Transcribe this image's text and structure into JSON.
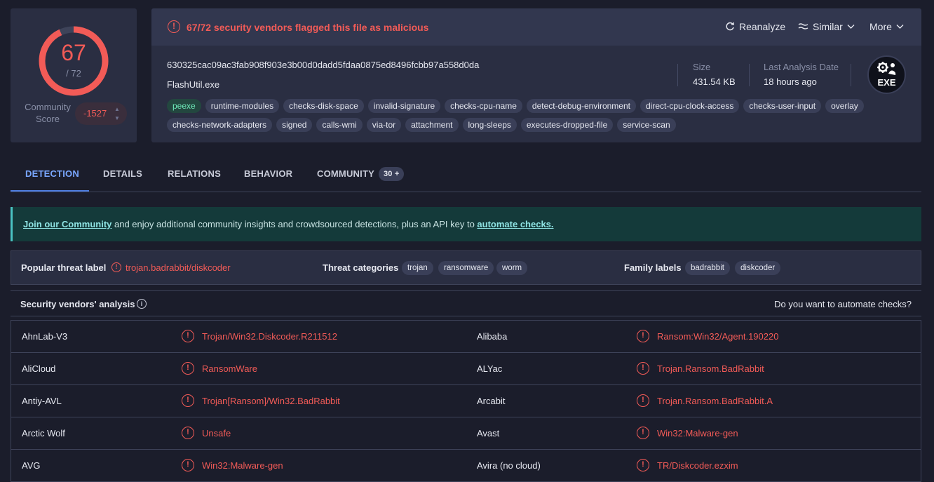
{
  "score": {
    "detected": "67",
    "total": "/ 72",
    "detected_ratio": 0.9306,
    "community_label": "Community Score",
    "community_value": "-1527",
    "ring_color": "#f25b57"
  },
  "summary": {
    "alert_text": "67/72 security vendors flagged this file as malicious",
    "actions": {
      "reanalyze": "Reanalyze",
      "similar": "Similar",
      "more": "More"
    },
    "hash": "630325cac09ac3fab908f903e3b00d0dadd5fdaa0875ed8496fcbb97a558d0da",
    "filename": "FlashUtil.exe",
    "size_label": "Size",
    "size_value": "431.54 KB",
    "date_label": "Last Analysis Date",
    "date_value": "18 hours ago",
    "file_type": "EXE",
    "tags_row1": [
      "peexe",
      "runtime-modules",
      "checks-disk-space",
      "invalid-signature",
      "checks-cpu-name",
      "detect-debug-environment",
      "direct-cpu-clock-access",
      "checks-user-input",
      "overlay"
    ],
    "tags_row2": [
      "checks-network-adapters",
      "signed",
      "calls-wmi",
      "via-tor",
      "attachment",
      "long-sleeps",
      "executes-dropped-file",
      "service-scan"
    ]
  },
  "tabs": {
    "detection": "DETECTION",
    "details": "DETAILS",
    "relations": "RELATIONS",
    "behavior": "BEHAVIOR",
    "community": "COMMUNITY",
    "community_count": "30 +"
  },
  "banner": {
    "link1": "Join our Community",
    "middle": " and enjoy additional community insights and crowdsourced detections, plus an API key to ",
    "link2": "automate checks."
  },
  "threat": {
    "popular_label": "Popular threat label",
    "popular_value": "trojan.badrabbit/diskcoder",
    "categories_label": "Threat categories",
    "categories": [
      "trojan",
      "ransomware",
      "worm"
    ],
    "family_label": "Family labels",
    "families": [
      "badrabbit",
      "diskcoder"
    ]
  },
  "vendors_header": {
    "title": "Security vendors' analysis",
    "right": "Do you want to automate checks?"
  },
  "vendors": [
    {
      "left_name": "AhnLab-V3",
      "left_result": "Trojan/Win32.Diskcoder.R211512",
      "right_name": "Alibaba",
      "right_result": "Ransom:Win32/Agent.190220"
    },
    {
      "left_name": "AliCloud",
      "left_result": "RansomWare",
      "right_name": "ALYac",
      "right_result": "Trojan.Ransom.BadRabbit"
    },
    {
      "left_name": "Antiy-AVL",
      "left_result": "Trojan[Ransom]/Win32.BadRabbit",
      "right_name": "Arcabit",
      "right_result": "Trojan.Ransom.BadRabbit.A"
    },
    {
      "left_name": "Arctic Wolf",
      "left_result": "Unsafe",
      "right_name": "Avast",
      "right_result": "Win32:Malware-gen"
    },
    {
      "left_name": "AVG",
      "left_result": "Win32:Malware-gen",
      "right_name": "Avira (no cloud)",
      "right_result": "TR/Diskcoder.ezxim"
    }
  ]
}
